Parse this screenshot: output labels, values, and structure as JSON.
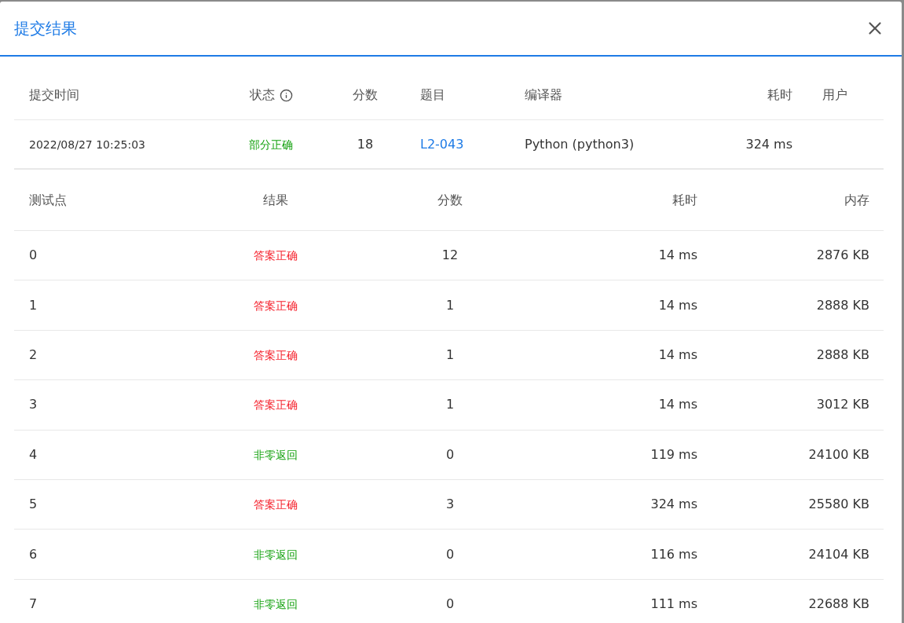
{
  "dialog": {
    "title": "提交结果"
  },
  "summary": {
    "columns": [
      "提交时间",
      "状态",
      "分数",
      "题目",
      "编译器",
      "耗时",
      "用户"
    ],
    "row": {
      "time": "2022/08/27 10:25:03",
      "status": "部分正确",
      "score": "18",
      "problem": "L2-043",
      "compiler": "Python (python3)",
      "duration": "324 ms"
    }
  },
  "tests": {
    "columns": [
      "测试点",
      "结果",
      "分数",
      "耗时",
      "内存"
    ],
    "rows": [
      {
        "case": "0",
        "result": "答案正确",
        "kind": "accepted",
        "score": "12",
        "time": "14 ms",
        "memory": "2876 KB"
      },
      {
        "case": "1",
        "result": "答案正确",
        "kind": "accepted",
        "score": "1",
        "time": "14 ms",
        "memory": "2888 KB"
      },
      {
        "case": "2",
        "result": "答案正确",
        "kind": "accepted",
        "score": "1",
        "time": "14 ms",
        "memory": "2888 KB"
      },
      {
        "case": "3",
        "result": "答案正确",
        "kind": "accepted",
        "score": "1",
        "time": "14 ms",
        "memory": "3012 KB"
      },
      {
        "case": "4",
        "result": "非零返回",
        "kind": "nonzero",
        "score": "0",
        "time": "119 ms",
        "memory": "24100 KB"
      },
      {
        "case": "5",
        "result": "答案正确",
        "kind": "accepted",
        "score": "3",
        "time": "324 ms",
        "memory": "25580 KB"
      },
      {
        "case": "6",
        "result": "非零返回",
        "kind": "nonzero",
        "score": "0",
        "time": "116 ms",
        "memory": "24104 KB"
      },
      {
        "case": "7",
        "result": "非零返回",
        "kind": "nonzero",
        "score": "0",
        "time": "111 ms",
        "memory": "22688 KB"
      }
    ]
  }
}
